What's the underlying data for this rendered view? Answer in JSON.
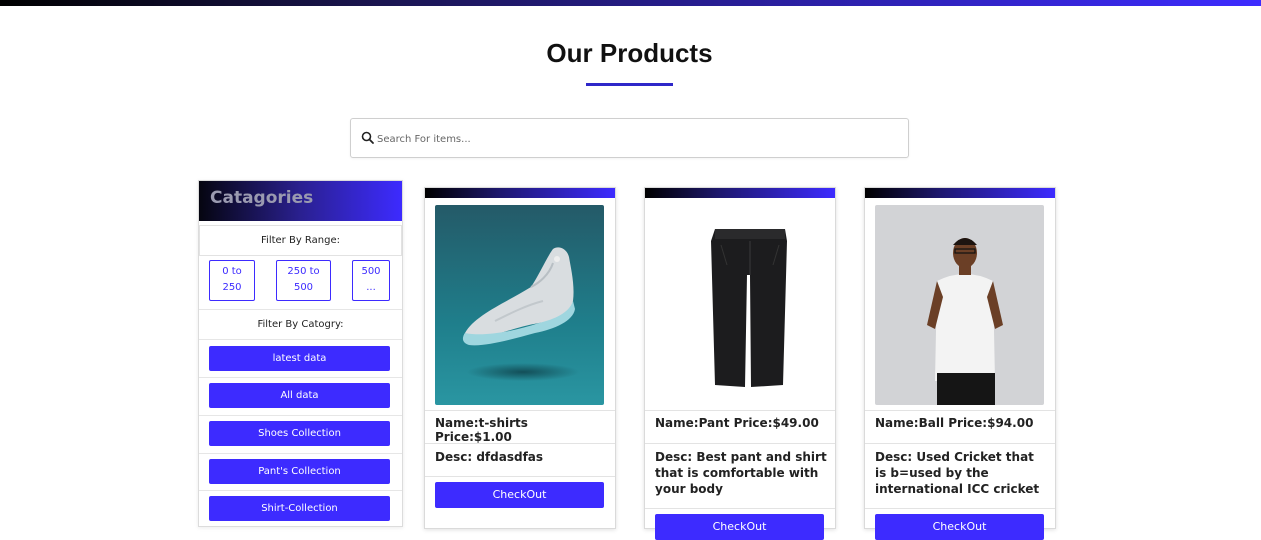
{
  "header": {
    "title": "Our Products"
  },
  "search": {
    "placeholder": "Search For items..."
  },
  "sidebar": {
    "title": "Catagories",
    "range_label": "Filter By Range:",
    "ranges": [
      {
        "line1": "0 to",
        "line2": "250"
      },
      {
        "line1": "250 to",
        "line2": "500"
      },
      {
        "line1": "500",
        "line2": "..."
      }
    ],
    "category_label": "Filter By Catogry:",
    "categories": [
      "latest data",
      "All data",
      "Shoes Collection",
      "Pant's Collection",
      "Shirt-Collection"
    ]
  },
  "products": [
    {
      "name_line": "Name:t-shirts Price:$1.00",
      "desc_line": "Desc: dfdasdfas",
      "button": "CheckOut",
      "image_icon": "sneaker-image"
    },
    {
      "name_line": "Name:Pant Price:$49.00",
      "desc_line": "Desc: Best pant and shirt that is comfortable with your body",
      "button": "CheckOut",
      "image_icon": "pants-image"
    },
    {
      "name_line": "Name:Ball Price:$94.00",
      "desc_line": "Desc: Used Cricket that is b=used by the international ICC cricket",
      "button": "CheckOut",
      "image_icon": "person-image"
    }
  ],
  "colors": {
    "accent": "#3d2bff",
    "underline": "#2e27c9"
  }
}
